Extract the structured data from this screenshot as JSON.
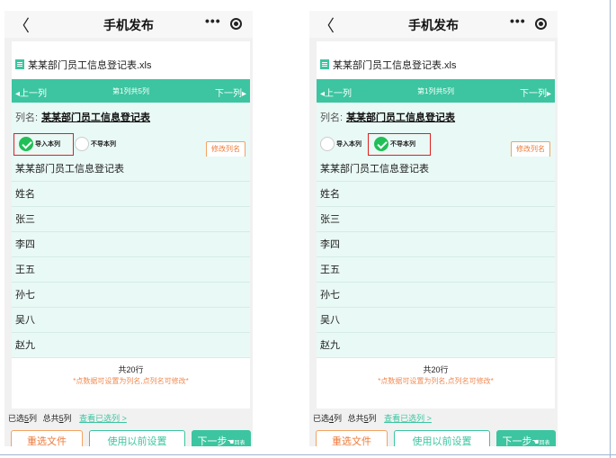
{
  "phones": [
    {
      "title": "手机发布",
      "back_glyph": "〈",
      "menu_glyph": "•••",
      "file_name": "某某部门员工信息登记表.xls",
      "nav": {
        "prev": "◂上一列",
        "info": "第1列共5列",
        "next": "下一列▸"
      },
      "column": {
        "label": "列名:",
        "name": "某某部门员工信息登记表"
      },
      "options": {
        "import": "导入本列",
        "skip": "不导本列",
        "selected": "import"
      },
      "edit_label": "修改列名",
      "rows": [
        "某某部门员工信息登记表",
        "姓名",
        "张三",
        "李四",
        "王五",
        "孙七",
        "吴八",
        "赵九"
      ],
      "total": "共20行",
      "tip": "*点数据可设置为列名,点列名可修改*",
      "stats": {
        "selected_prefix": "已选",
        "selected_count": "5",
        "selected_suffix": "列",
        "total_prefix": "总共",
        "total_count": "5",
        "total_suffix": "列",
        "link": "查看已选列 >"
      },
      "buttons": {
        "reselect": "重选文件",
        "use_prev": "使用以前设置",
        "next": "下一步",
        "next_hand": "☚",
        "next_sub": "回表"
      }
    },
    {
      "title": "手机发布",
      "back_glyph": "〈",
      "menu_glyph": "•••",
      "file_name": "某某部门员工信息登记表.xls",
      "nav": {
        "prev": "◂上一列",
        "info": "第1列共5列",
        "next": "下一列▸"
      },
      "column": {
        "label": "列名:",
        "name": "某某部门员工信息登记表"
      },
      "options": {
        "import": "导入本列",
        "skip": "不导本列",
        "selected": "skip"
      },
      "edit_label": "修改列名",
      "rows": [
        "某某部门员工信息登记表",
        "姓名",
        "张三",
        "李四",
        "王五",
        "孙七",
        "吴八",
        "赵九"
      ],
      "total": "共20行",
      "tip": "*点数据可设置为列名,点列名可修改*",
      "stats": {
        "selected_prefix": "已选",
        "selected_count": "4",
        "selected_suffix": "列",
        "total_prefix": "总共",
        "total_count": "5",
        "total_suffix": "列",
        "link": "查看已选列 >"
      },
      "buttons": {
        "reselect": "重选文件",
        "use_prev": "使用以前设置",
        "next": "下一步",
        "next_hand": "☚",
        "next_sub": "回表"
      }
    }
  ],
  "colors": {
    "accent": "#3cc5a0",
    "check": "#21bf57",
    "highlight": "#e02020",
    "orange": "#ee7a3a"
  }
}
